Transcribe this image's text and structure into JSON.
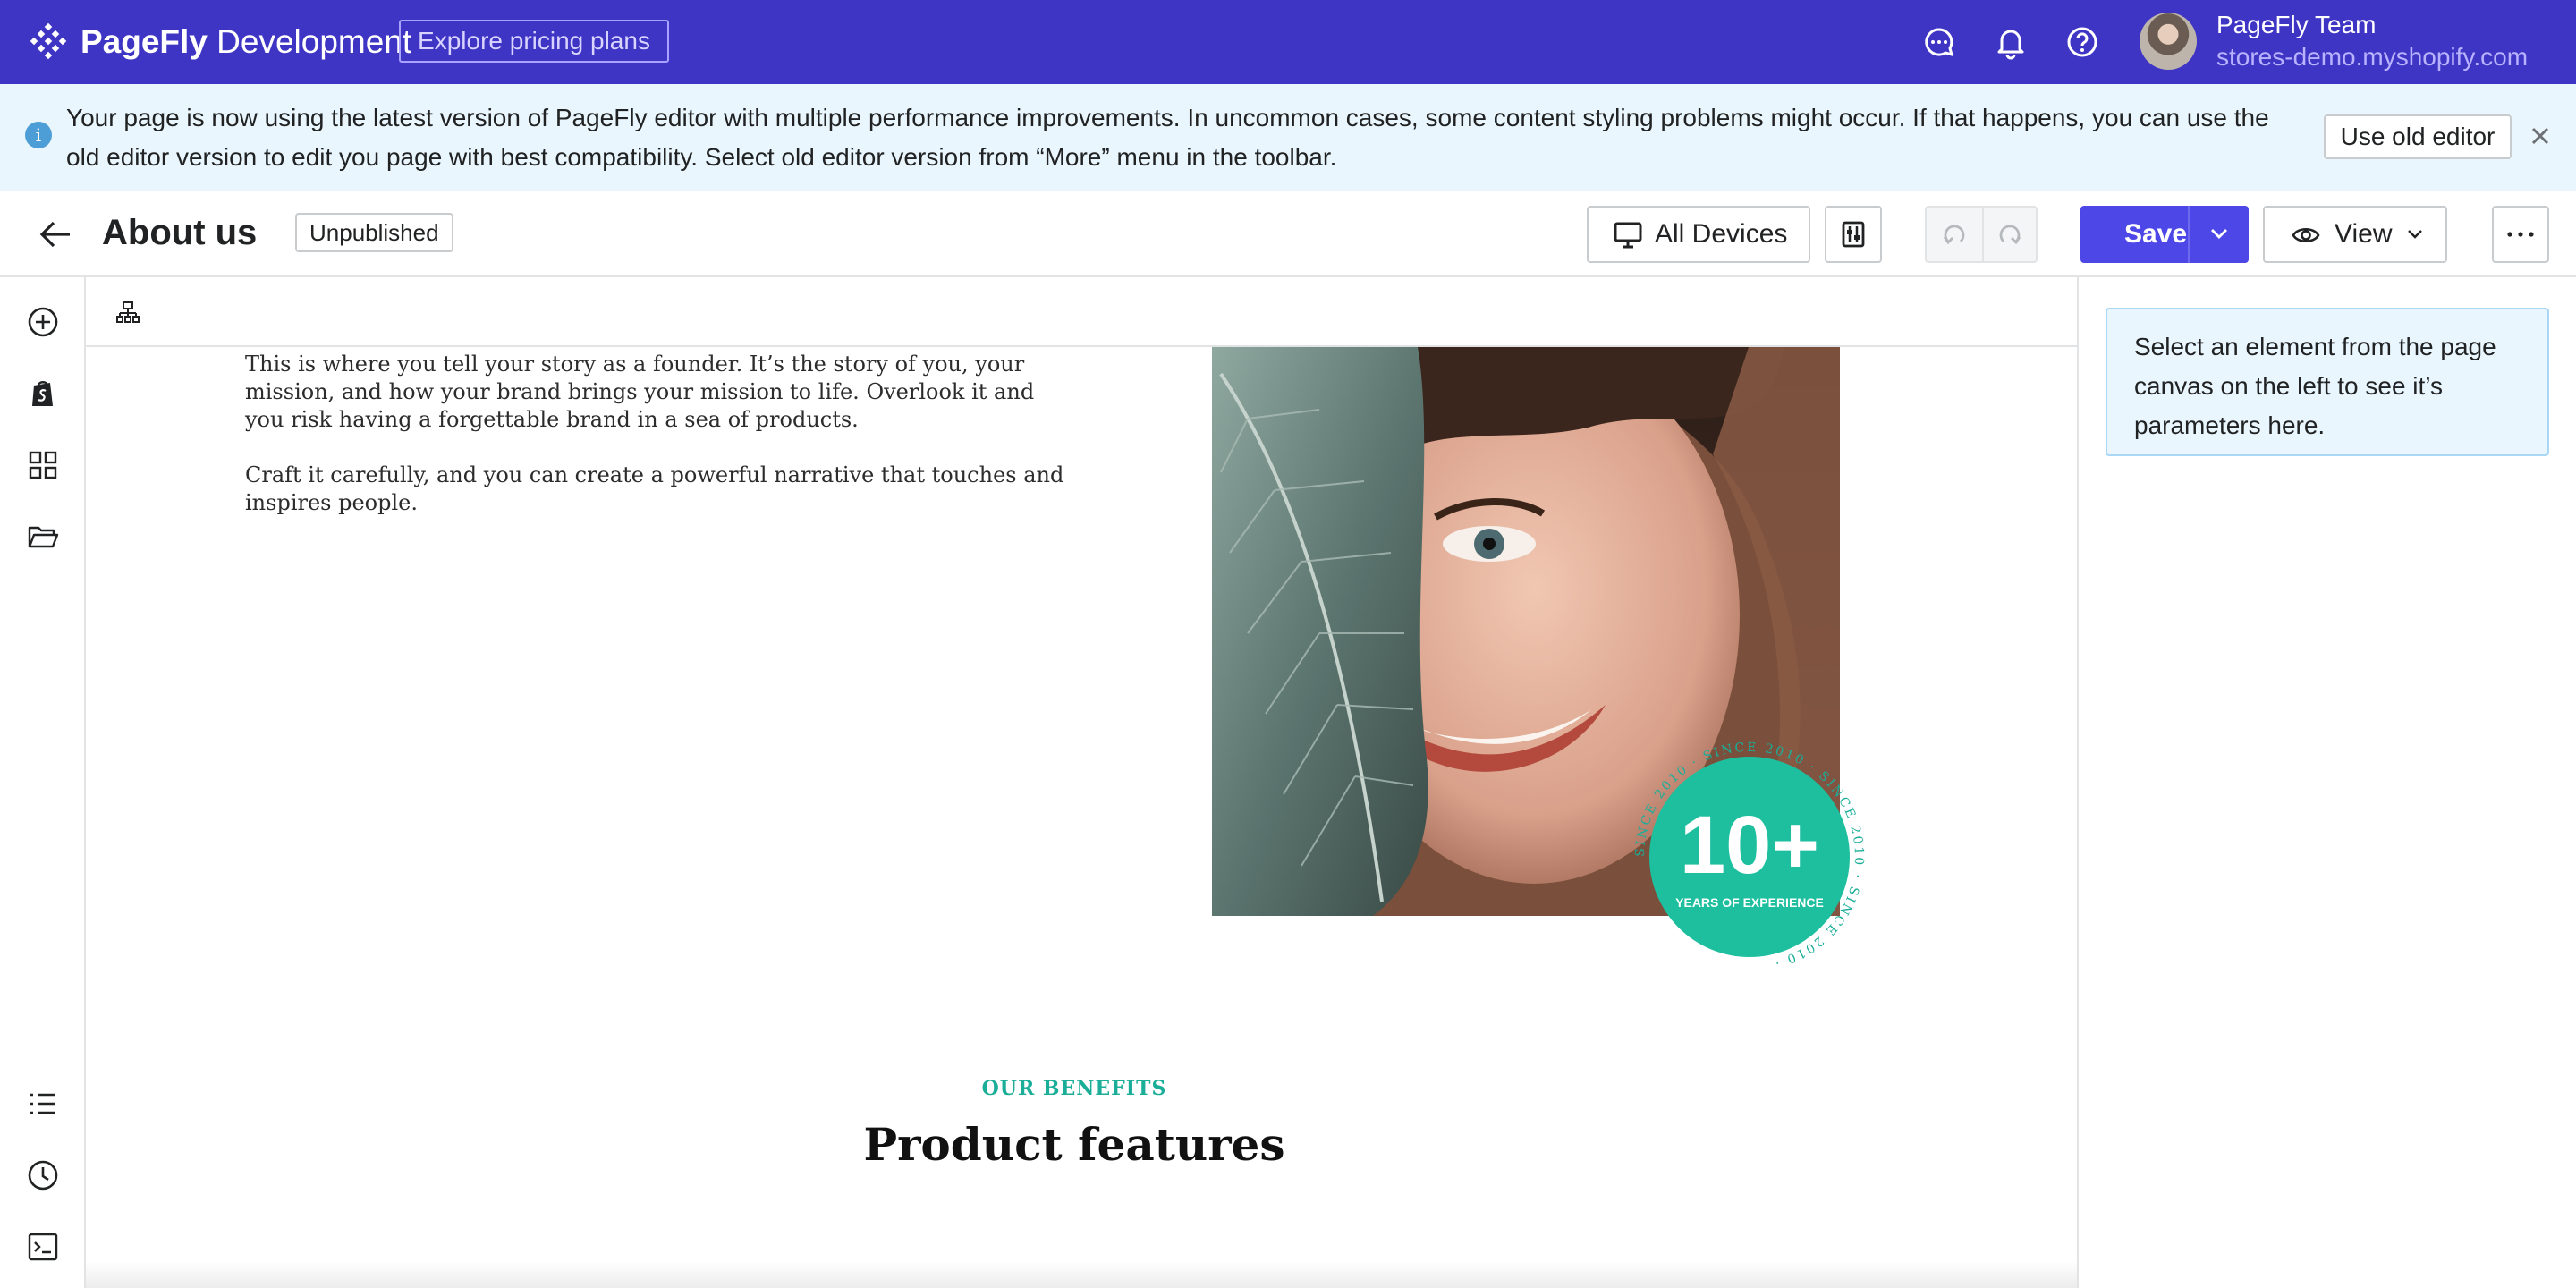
{
  "topbar": {
    "brand_bold": "PageFly",
    "brand_rest": " Development",
    "pricing_label": "Explore pricing plans",
    "icons": [
      "chat-icon",
      "bell-icon",
      "help-icon"
    ],
    "user": {
      "name": "PageFly Team",
      "store": "stores-demo.myshopify.com"
    }
  },
  "banner": {
    "message": "Your page is now using the latest version of PageFly editor with multiple performance improvements. In uncommon cases, some content styling problems might occur. If that happens, you can use the old editor version to edit you page with best compatibility. Select old editor version from “More” menu in the toolbar.",
    "button_label": "Use old editor",
    "info_glyph": "i"
  },
  "toolbar": {
    "title": "About us",
    "status": "Unpublished",
    "devices_label": "All Devices",
    "save_label": "Save",
    "view_label": "View",
    "more_glyph": "···"
  },
  "left_rail": {
    "icons": [
      "add-icon",
      "shopify-icon",
      "grid-icon",
      "folder-icon",
      "list-icon",
      "history-icon",
      "terminal-icon"
    ]
  },
  "canvas": {
    "story_p1": "This is where you tell your story as a founder. It’s the story of you, your mission, and how your brand brings your mission to life. Overlook it and you risk having a forgettable brand in a sea of products.",
    "story_p2": "Craft it carefully, and you can create a powerful narrative that touches and inspires people.",
    "badge": {
      "number": "10+",
      "caption": "YEARS OF EXPERIENCE",
      "ring_text": "SINCE 2010 · SINCE 2010 · SINCE 2010 · SINCE 2010 ·",
      "color": "#1dbf9f"
    },
    "eyebrow": "OUR BENEFITS",
    "section_title": "Product features"
  },
  "right_panel": {
    "hint": "Select an element from the page canvas on the left to see it’s parameters here."
  },
  "colors": {
    "topbar": "#3f35c4",
    "primary": "#4e47e8",
    "banner_bg": "#eaf6fd",
    "accent_teal": "#1aae99"
  }
}
